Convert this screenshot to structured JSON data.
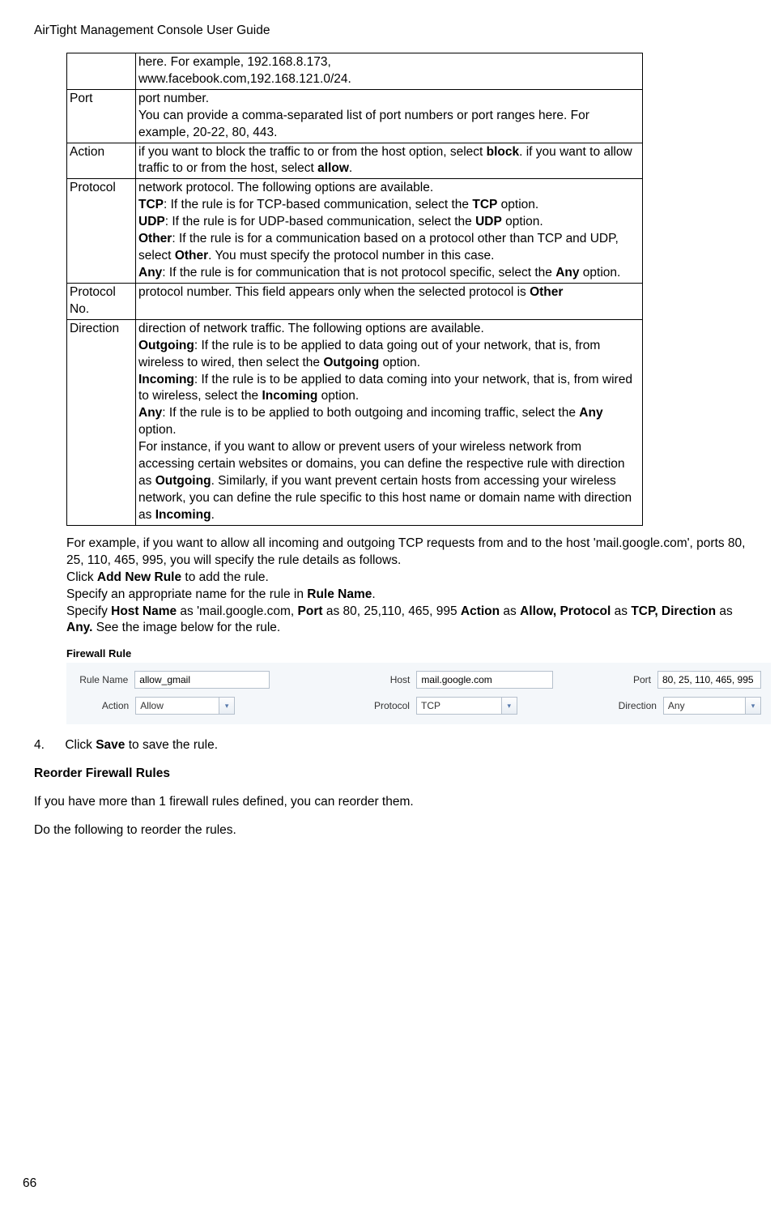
{
  "header": "AirTight Management Console User Guide",
  "page_number": "66",
  "table": {
    "row0": {
      "desc_a": "here. For example, 192.168.8.173,",
      "desc_b": "www.facebook.com,192.168.121.0/24."
    },
    "port": {
      "name": "Port",
      "desc_a": "port number.",
      "desc_b": "You can provide a comma-separated list of port numbers or port ranges here. For example, 20-22, 80, 443."
    },
    "action": {
      "name": "Action",
      "desc_a": "if you want to block the traffic to or from the host option, select ",
      "desc_b": ". if you want to allow traffic to or from the host, select ",
      "block": "block",
      "allow": "allow",
      "dot": "."
    },
    "protocol": {
      "name": "Protocol",
      "l1": "network protocol. The following options are available.",
      "tcp_b": "TCP",
      "tcp_t": ": If the rule is for TCP-based communication, select the ",
      "tcp_b2": "TCP",
      "opt1": " option.",
      "udp_b": "UDP",
      "udp_t": ": If the rule is for UDP-based communication, select the ",
      "udp_b2": "UDP",
      "opt2": " option.",
      "oth_b": "Other",
      "oth_t1": ": If the rule is for a communication based on a protocol other than TCP and UDP, select ",
      "oth_b2": "Other",
      "oth_t2": ". You must specify the protocol number in this case.",
      "any_b": "Any",
      "any_t1": ": If the rule is for communication that is not protocol specific, select the ",
      "any_b2": "Any",
      "any_t2": " option."
    },
    "protono": {
      "name": "Protocol No.",
      "desc_a": "protocol number. This field appears only when the selected protocol is ",
      "other": "Other"
    },
    "direction": {
      "name": "Direction",
      "l1": "direction of network traffic. The following options are available.",
      "out_b": "Outgoing",
      "out_t1": ": If the rule is to be applied to data going out of your network, that is, from wireless to wired, then select the ",
      "out_b2": "Outgoing",
      "out_t2": " option.",
      "in_b": "Incoming",
      "in_t1": ": If the rule is to be applied to data coming into your network, that is, from wired to wireless, select the ",
      "in_b2": "Incoming",
      "in_t2": " option.",
      "any_b": "Any",
      "any_t1": ":  If the rule is to be applied to both outgoing and incoming traffic, select the ",
      "any_b2": "Any",
      "any_t2": " option.",
      "ex1": "For instance, if you want to allow or prevent users of your wireless network from accessing certain websites or domains, you can define the respective rule with direction as ",
      "ex_b1": "Outgoing",
      "ex2": ". Similarly, if you want prevent certain hosts from accessing your wireless network, you can define the rule specific to this host name or domain name with direction as ",
      "ex_b2": "Incoming",
      "ex3": "."
    }
  },
  "example": {
    "p1": "For example, if you want to allow all incoming and outgoing TCP requests from and to the host 'mail.google.com', ports 80, 25, 110, 465, 995, you will specify the rule details as follows.",
    "p2a": "Click ",
    "p2b": "Add New Rule",
    "p2c": " to add the rule.",
    "p3a": "Specify an appropriate name for the rule in ",
    "p3b": "Rule Name",
    "p3c": ".",
    "p4a": "Specify ",
    "hostname_b": "Host Name",
    "p4b": " as 'mail.google.com, ",
    "port_b": "Port",
    "p4c": " as 80, 25,110, 465, 995 ",
    "action_b": "Action",
    "p4d": " as ",
    "allow_b": "Allow, Protocol",
    "p4e": " as ",
    "tcp_b": "TCP, Direction",
    "p4f": " as ",
    "any_b": "Any.",
    "p4g": "  See the image below for the rule."
  },
  "rule": {
    "title": "Firewall Rule",
    "labels": {
      "rulename": "Rule Name",
      "host": "Host",
      "port": "Port",
      "action": "Action",
      "protocol": "Protocol",
      "direction": "Direction"
    },
    "values": {
      "rulename": "allow_gmail",
      "host": "mail.google.com",
      "port": "80, 25, 110, 465, 995",
      "action": "Allow",
      "protocol": "TCP",
      "direction": "Any"
    }
  },
  "step4": {
    "num": "4.",
    "a": "Click ",
    "b": "Save",
    "c": " to save the rule."
  },
  "reorder": {
    "h": "Reorder Firewall Rules",
    "p1": "If you have more than 1 firewall rules defined, you can reorder them.",
    "p2": "Do the following to reorder the rules."
  }
}
